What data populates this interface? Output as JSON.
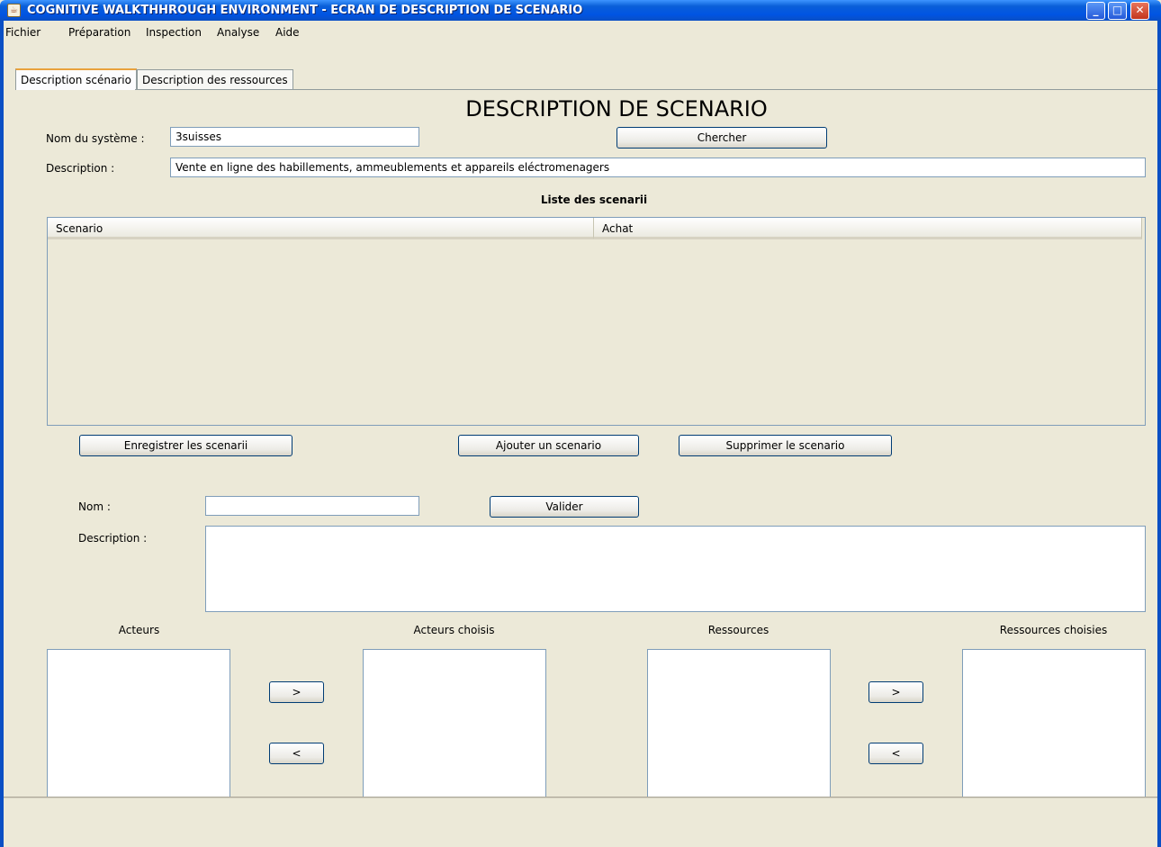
{
  "window": {
    "title": "COGNITIVE WALKTHHROUGH ENVIRONMENT - ECRAN DE DESCRIPTION DE SCENARIO",
    "controls": {
      "minimize": "_",
      "maximize": "□",
      "close": "✕"
    }
  },
  "menu": [
    "Fichier",
    "Préparation",
    "Inspection",
    "Analyse",
    "Aide"
  ],
  "tabs": [
    "Description scénario",
    "Description des ressources"
  ],
  "header": {
    "title": "DESCRIPTION DE SCENARIO"
  },
  "system": {
    "name_label": "Nom du système :",
    "name_value": "3suisses",
    "search_button": "Chercher",
    "description_label": "Description :",
    "description_value": "Vente en ligne des habillements, ammeublements et appareils eléctromenagers"
  },
  "scenario_list": {
    "title": "Liste des scenarii",
    "columns": [
      "Scenario",
      "Achat"
    ],
    "rows": []
  },
  "actions": {
    "save": "Enregistrer les scenarii",
    "add": "Ajouter un scenario",
    "delete": "Supprimer le scenario"
  },
  "form": {
    "name_label": "Nom :",
    "name_value": "",
    "validate_button": "Valider",
    "description_label": "Description :",
    "description_value": ""
  },
  "lists": {
    "actors": "Acteurs",
    "chosen_actors": "Acteurs choisis",
    "resources": "Ressources",
    "chosen_resources": "Ressources choisies",
    "move_right": ">",
    "move_left": "<"
  }
}
